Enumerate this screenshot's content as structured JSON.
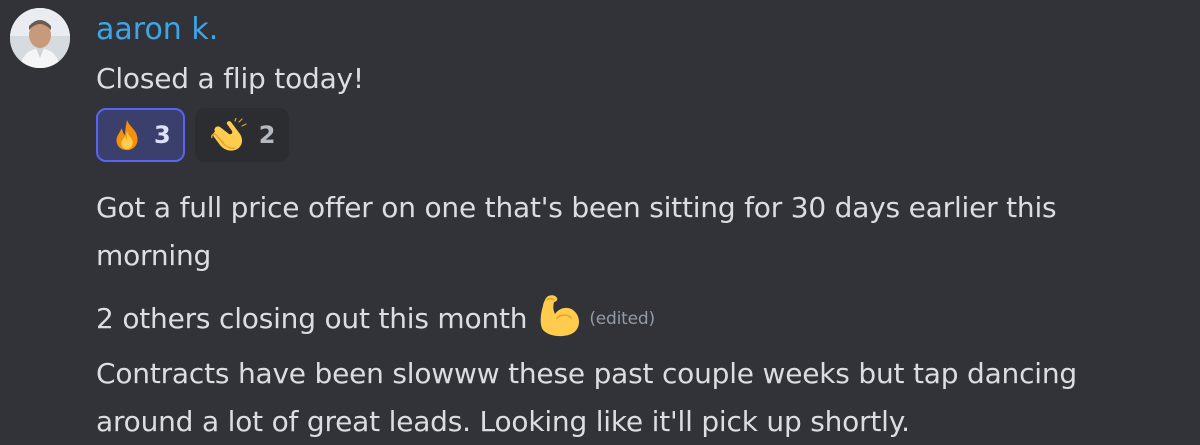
{
  "message": {
    "author": "aaron k.",
    "lines": {
      "l1": "Closed a flip today!",
      "l2a": "Got a full price offer on one that's been sitting for 30 days earlier this",
      "l2b": "morning",
      "l3": "2 others closing out this month",
      "l3_emoji": "flexed-biceps-icon",
      "l3_edited": "(edited)",
      "l4a": "Contracts have been slowww these past couple weeks but tap dancing",
      "l4b": "around a lot of great leads. Looking like it'll pick up shortly."
    },
    "reactions": [
      {
        "emoji": "fire-icon",
        "count": "3",
        "active": true
      },
      {
        "emoji": "clapping-hands-icon",
        "count": "2",
        "active": false
      }
    ]
  },
  "colors": {
    "background": "#313338",
    "username": "#3ea6e6",
    "text": "#dbdee1",
    "reaction_active_bg": "#3b3f6b",
    "reaction_active_border": "#5865f2",
    "reaction_bg": "#2b2d31",
    "muted": "#949ba4"
  }
}
